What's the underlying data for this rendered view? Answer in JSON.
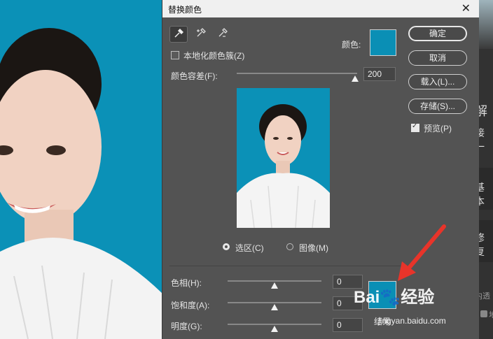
{
  "dialog": {
    "title": "替换颜色",
    "close_glyph": "✕",
    "localized_clusters_label": "本地化颜色簇(Z)",
    "color_label": "颜色:",
    "tolerance_label": "颜色容差(F):",
    "tolerance_value": "200",
    "tolerance_level": 1.0,
    "radio_selection_label": "选区(C)",
    "radio_image_label": "图像(M)",
    "hue_label": "色相(H):",
    "hue_value": "0",
    "saturation_label": "饱和度(A):",
    "saturation_value": "0",
    "lightness_label": "明度(G):",
    "lightness_value": "0",
    "result_label": "结果",
    "preview_check_label": "预览(P)"
  },
  "buttons": {
    "ok": "确定",
    "cancel": "取消",
    "load": "载入(L)...",
    "save": "存储(S)..."
  },
  "colors": {
    "target_color": "#0a8fb5",
    "result_color": "#0a8fb5",
    "dialog_bg": "#535353"
  },
  "right_panel": {
    "t1": "解",
    "t2": "接",
    "t3": "一",
    "t4": "基本",
    "t5": "修复",
    "t6": "内透",
    "t7": "地"
  },
  "watermark": {
    "brand": "Bai",
    "brand_suffix": "经验",
    "url": "jingyan.baidu.com"
  }
}
